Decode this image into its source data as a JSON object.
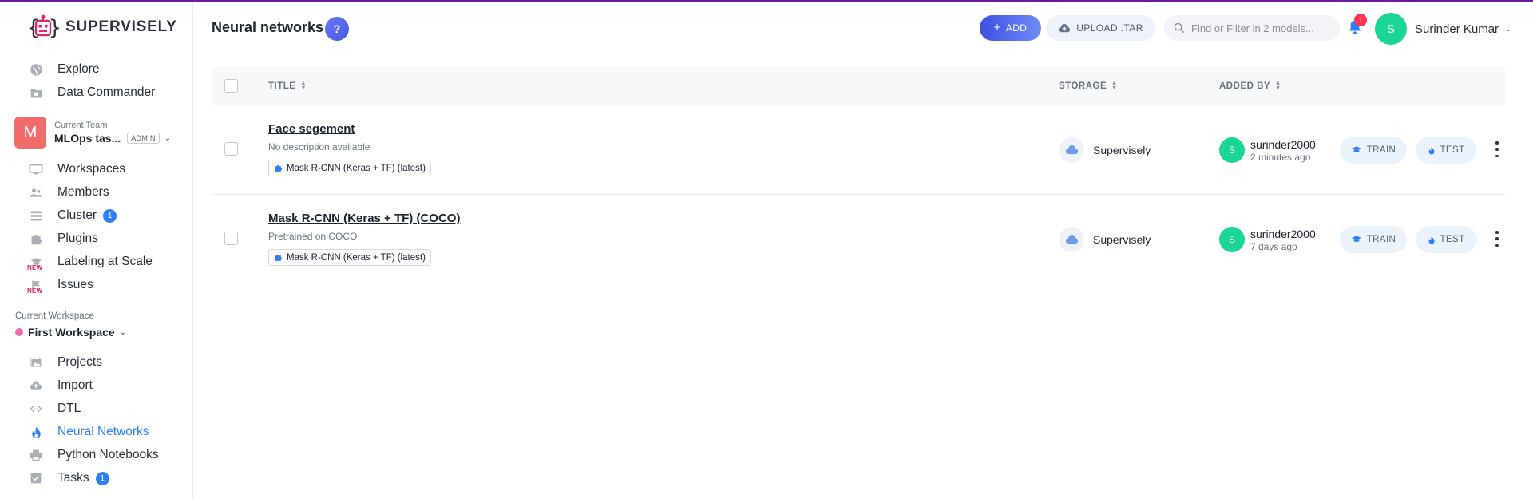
{
  "app": {
    "name": "SUPERVISELY",
    "accent_color": "#2d7ff9",
    "logo_color": "#e0246e"
  },
  "sidebar": {
    "top_items": [
      {
        "label": "Explore",
        "icon": "globe-icon"
      },
      {
        "label": "Data Commander",
        "icon": "folder-icon"
      }
    ],
    "team": {
      "avatar_letter": "M",
      "caption": "Current Team",
      "name": "MLOps tas...",
      "role": "ADMIN"
    },
    "team_items": [
      {
        "label": "Workspaces",
        "icon": "monitor-icon"
      },
      {
        "label": "Members",
        "icon": "users-icon"
      },
      {
        "label": "Cluster",
        "icon": "list-icon",
        "badge": "1"
      },
      {
        "label": "Plugins",
        "icon": "puzzle-icon"
      },
      {
        "label": "Labeling at Scale",
        "icon": "graduation-cap-icon",
        "new": "NEW"
      },
      {
        "label": "Issues",
        "icon": "flag-icon",
        "new": "NEW"
      }
    ],
    "workspace": {
      "caption": "Current Workspace",
      "name": "First Workspace",
      "dot_color": "#ef6ab0"
    },
    "workspace_items": [
      {
        "label": "Projects",
        "icon": "images-icon"
      },
      {
        "label": "Import",
        "icon": "cloud-upload-icon"
      },
      {
        "label": "DTL",
        "icon": "code-icon"
      },
      {
        "label": "Neural Networks",
        "icon": "flame-icon",
        "active": true
      },
      {
        "label": "Python Notebooks",
        "icon": "printer-icon"
      },
      {
        "label": "Tasks",
        "icon": "checkbox-icon",
        "badge": "1"
      }
    ]
  },
  "header": {
    "title": "Neural networks",
    "help_label": "?",
    "add_label": "ADD",
    "upload_label": "UPLOAD .TAR",
    "search_placeholder": "Find or Filter in 2 models...",
    "notification_count": "1",
    "user": {
      "avatar_letter": "S",
      "name": "Surinder Kumar"
    }
  },
  "table": {
    "columns": {
      "title": "TITLE",
      "storage": "STORAGE",
      "added_by": "ADDED BY"
    },
    "rows": [
      {
        "title": "Face segement",
        "description": "No description available",
        "plugin": "Mask R-CNN (Keras + TF) (latest)",
        "storage": "Supervisely",
        "user_letter": "S",
        "user": "surinder2000",
        "time": "2 minutes ago",
        "train_label": "TRAIN",
        "test_label": "TEST"
      },
      {
        "title": "Mask R-CNN (Keras + TF) (COCO)",
        "description": "Pretrained on COCO",
        "plugin": "Mask R-CNN (Keras + TF) (latest)",
        "storage": "Supervisely",
        "user_letter": "S",
        "user": "surinder2000",
        "time": "7 days ago",
        "train_label": "TRAIN",
        "test_label": "TEST"
      }
    ]
  }
}
